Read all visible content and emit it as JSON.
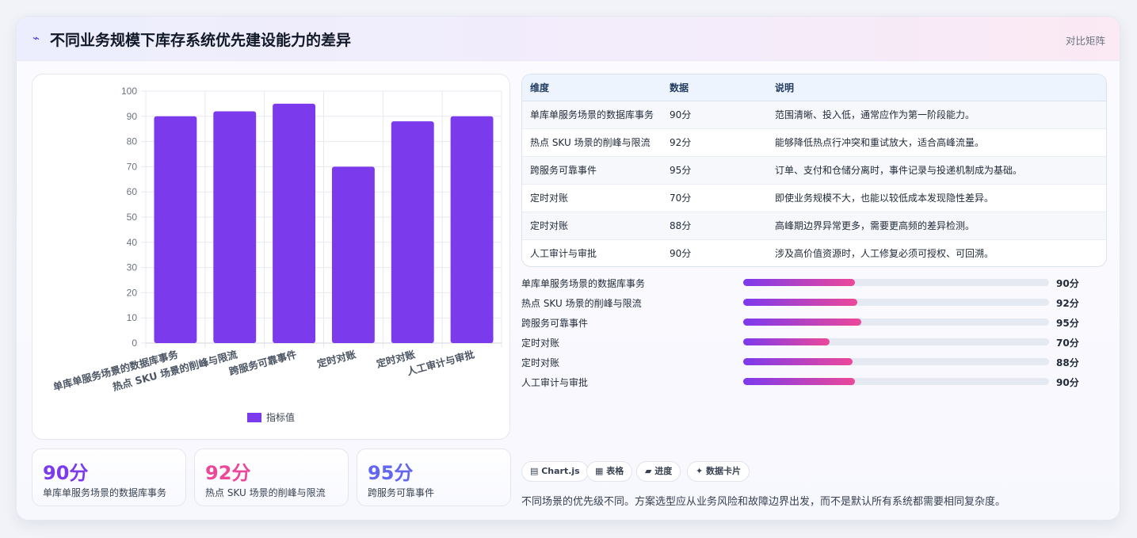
{
  "header": {
    "icon": "line-chart-icon",
    "title": "不同业务规模下库存系统优先建设能力的差异",
    "tag": "对比矩阵"
  },
  "chart_data": {
    "type": "bar",
    "categories": [
      "单库单服务场景的数据库事务",
      "热点 SKU 场景的削峰与限流",
      "跨服务可靠事件",
      "定时对账",
      "定时对账",
      "人工审计与审批"
    ],
    "series": [
      {
        "name": "指标值",
        "values": [
          90,
          92,
          95,
          70,
          88,
          90
        ],
        "color": "#7c3aed"
      }
    ],
    "ylim": [
      0,
      100
    ],
    "yticks": [
      0,
      10,
      20,
      30,
      40,
      50,
      60,
      70,
      80,
      90,
      100
    ],
    "legend_position": "bottom",
    "grid": true
  },
  "stats": [
    {
      "value": "90分",
      "label": "单库单服务场景的数据库事务",
      "color": "#7c3aed"
    },
    {
      "value": "92分",
      "label": "热点 SKU 场景的削峰与限流",
      "color": "#ec4899"
    },
    {
      "value": "95分",
      "label": "跨服务可靠事件",
      "color": "#6366f1"
    }
  ],
  "table": {
    "headers": [
      "维度",
      "数据",
      "说明"
    ],
    "rows": [
      [
        "单库单服务场景的数据库事务",
        "90分",
        "范围清晰、投入低，通常应作为第一阶段能力。"
      ],
      [
        "热点 SKU 场景的削峰与限流",
        "92分",
        "能够降低热点行冲突和重试放大，适合高峰流量。"
      ],
      [
        "跨服务可靠事件",
        "95分",
        "订单、支付和仓储分离时，事件记录与投递机制成为基础。"
      ],
      [
        "定时对账",
        "70分",
        "即使业务规模不大，也能以较低成本发现隐性差异。"
      ],
      [
        "定时对账",
        "88分",
        "高峰期边界异常更多，需要更高频的差异检测。"
      ],
      [
        "人工审计与审批",
        "90分",
        "涉及高价值资源时，人工修复必须可授权、可回溯。"
      ]
    ]
  },
  "progress": [
    {
      "label": "单库单服务场景的数据库事务",
      "value": 90,
      "text": "90分"
    },
    {
      "label": "热点 SKU 场景的削峰与限流",
      "value": 92,
      "text": "92分"
    },
    {
      "label": "跨服务可靠事件",
      "value": 95,
      "text": "95分"
    },
    {
      "label": "定时对账",
      "value": 70,
      "text": "70分"
    },
    {
      "label": "定时对账",
      "value": 88,
      "text": "88分"
    },
    {
      "label": "人工审计与审批",
      "value": 90,
      "text": "90分"
    }
  ],
  "chips": [
    {
      "label": "▤ Chart.js",
      "icon": "chart-icon"
    },
    {
      "label": "▦ 表格",
      "icon": "table-icon"
    },
    {
      "label": "▰ 进度",
      "icon": "progress-icon"
    },
    {
      "label": "✦ 数据卡片",
      "icon": "card-icon"
    }
  ],
  "note": "不同场景的优先级不同。方案选型应从业务风险和故障边界出发，而不是默认所有系统都需要相同复杂度。"
}
